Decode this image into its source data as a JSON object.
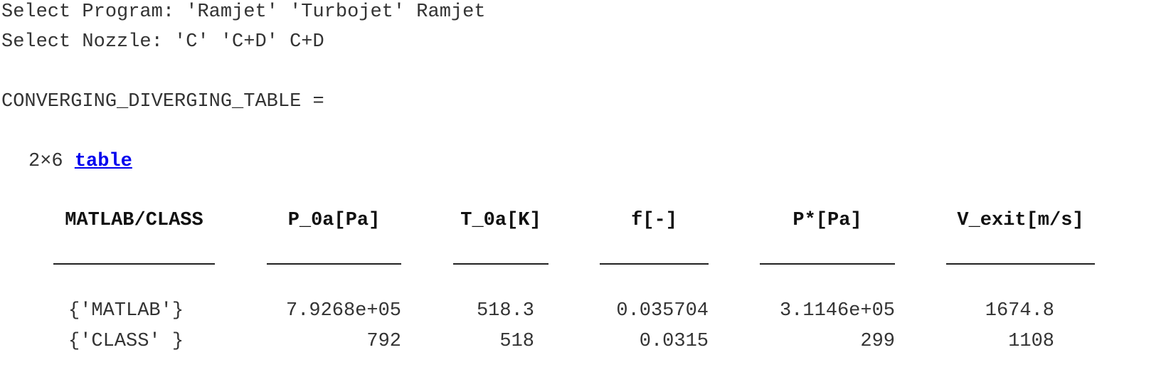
{
  "console": {
    "program_line": "Select Program: 'Ramjet' 'Turbojet' Ramjet",
    "nozzle_line": "Select Nozzle: 'C' 'C+D' C+D",
    "var_line": "CONVERGING_DIVERGING_TABLE =",
    "dims": "2×6 ",
    "table_link": "table"
  },
  "table": {
    "headers": [
      "MATLAB/CLASS",
      "P_0a[Pa]",
      "T_0a[K]",
      "f[-]",
      "P*[Pa]",
      "V_exit[m/s]"
    ],
    "rows": [
      [
        "{'MATLAB'}",
        "7.9268e+05",
        "518.3",
        "0.035704",
        "3.1146e+05",
        "1674.8"
      ],
      [
        "{'CLASS' }",
        "792",
        "518",
        "0.0315",
        "299",
        "1108"
      ]
    ]
  }
}
